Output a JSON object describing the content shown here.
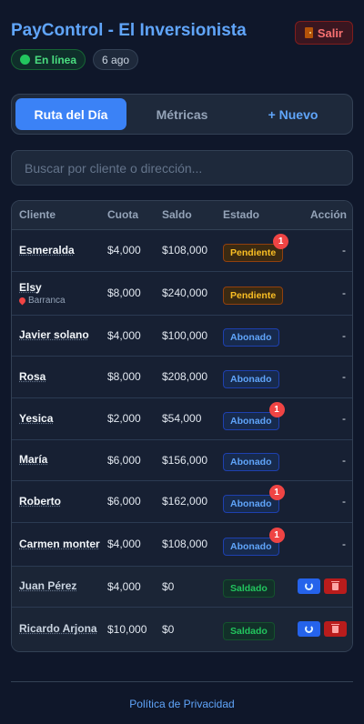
{
  "header": {
    "title": "PayControl - El Inversionista",
    "logout_label": "Salir",
    "online_label": "En línea",
    "date_label": "6 ago"
  },
  "tabs": [
    {
      "label": "Ruta del Día",
      "active": true
    },
    {
      "label": "Métricas",
      "active": false
    },
    {
      "label": "+ Nuevo",
      "active": false
    }
  ],
  "search": {
    "placeholder": "Buscar por cliente o dirección...",
    "value": ""
  },
  "table": {
    "columns": [
      "Cliente",
      "Cuota",
      "Saldo",
      "Estado",
      "Acción"
    ],
    "rows": [
      {
        "name": "Esmeralda",
        "sub": "",
        "cuota": "$4,000",
        "saldo": "$108,000",
        "status": "Pendiente",
        "notif": "1",
        "action": "-"
      },
      {
        "name": "Elsy",
        "sub": "Barranca",
        "cuota": "$8,000",
        "saldo": "$240,000",
        "status": "Pendiente",
        "notif": "",
        "action": "-"
      },
      {
        "name": "Javier solano",
        "sub": "",
        "cuota": "$4,000",
        "saldo": "$100,000",
        "status": "Abonado",
        "notif": "",
        "action": "-"
      },
      {
        "name": "Rosa",
        "sub": "",
        "cuota": "$8,000",
        "saldo": "$208,000",
        "status": "Abonado",
        "notif": "",
        "action": "-"
      },
      {
        "name": "Yesica",
        "sub": "",
        "cuota": "$2,000",
        "saldo": "$54,000",
        "status": "Abonado",
        "notif": "1",
        "action": "-"
      },
      {
        "name": "María",
        "sub": "",
        "cuota": "$6,000",
        "saldo": "$156,000",
        "status": "Abonado",
        "notif": "",
        "action": "-"
      },
      {
        "name": "Roberto",
        "sub": "",
        "cuota": "$6,000",
        "saldo": "$162,000",
        "status": "Abonado",
        "notif": "1",
        "action": "-"
      },
      {
        "name": "Carmen monter",
        "sub": "",
        "cuota": "$4,000",
        "saldo": "$108,000",
        "status": "Abonado",
        "notif": "1",
        "action": "-"
      },
      {
        "name": "Juan Pérez",
        "sub": "",
        "cuota": "$4,000",
        "saldo": "$0",
        "status": "Saldado",
        "notif": "",
        "action": ""
      },
      {
        "name": "Ricardo Arjona",
        "sub": "",
        "cuota": "$10,000",
        "saldo": "$0",
        "status": "Saldado",
        "notif": "",
        "action": ""
      }
    ]
  },
  "footer": {
    "privacy_label": "Política de Privacidad"
  },
  "colors": {
    "accent": "#3b82f6",
    "pending": "#fbbf24",
    "paid_partial": "#60a5fa",
    "settled": "#22c55e",
    "danger": "#ef4444"
  }
}
